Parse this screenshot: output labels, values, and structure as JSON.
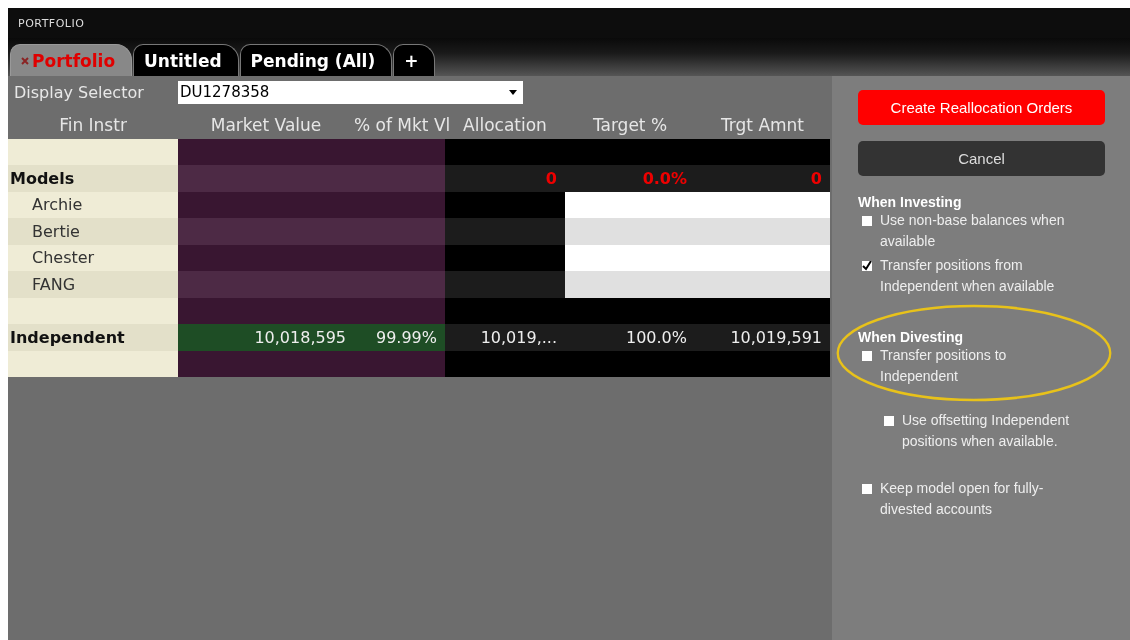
{
  "window": {
    "title": "PORTFOLIO"
  },
  "tabs": [
    {
      "label": "Portfolio",
      "selected": true,
      "closable": true
    },
    {
      "label": "Untitled",
      "selected": false,
      "closable": false
    },
    {
      "label": "Pending (All)",
      "selected": false,
      "closable": false
    },
    {
      "label": "+",
      "selected": false,
      "closable": false
    }
  ],
  "display_selector": {
    "label": "Display Selector",
    "value": "DU1278358"
  },
  "table": {
    "columns": [
      "Fin Instr",
      "Market Value",
      "% of Mkt Vl",
      "Allocation",
      "Target %",
      "Trgt Amnt"
    ],
    "rows": [
      {
        "kind": "spacer"
      },
      {
        "kind": "group",
        "name": "Models",
        "cells": [
          "",
          "",
          "0",
          "0.0%",
          "0"
        ],
        "negative": true
      },
      {
        "kind": "model",
        "name": "Archie"
      },
      {
        "kind": "model",
        "name": "Bertie"
      },
      {
        "kind": "model",
        "name": "Chester"
      },
      {
        "kind": "model",
        "name": "FANG"
      },
      {
        "kind": "spacer"
      },
      {
        "kind": "group",
        "name": "Independent",
        "cells": [
          "10,018,595",
          "99.99%",
          "10,019,...",
          "100.0%",
          "10,019,591"
        ],
        "negative": false
      },
      {
        "kind": "spacer"
      }
    ]
  },
  "actions": [
    {
      "label": "Create Reallocation Orders",
      "kind": "primary"
    },
    {
      "label": "Cancel",
      "kind": "secondary"
    }
  ],
  "option_groups": [
    {
      "title": "When Investing",
      "options": [
        {
          "label": "Use non-base balances when available",
          "checked": false
        },
        {
          "label": "Transfer positions from Independent when available",
          "checked": true
        }
      ]
    },
    {
      "title": "When Divesting",
      "highlighted": true,
      "options": [
        {
          "label": "Transfer positions to Independent",
          "checked": false,
          "children": [
            {
              "label": "Use offsetting Independent positions when available.",
              "checked": false
            }
          ]
        }
      ]
    },
    {
      "options": [
        {
          "label": "Keep model open for fully-divested accounts",
          "checked": false
        }
      ]
    }
  ]
}
